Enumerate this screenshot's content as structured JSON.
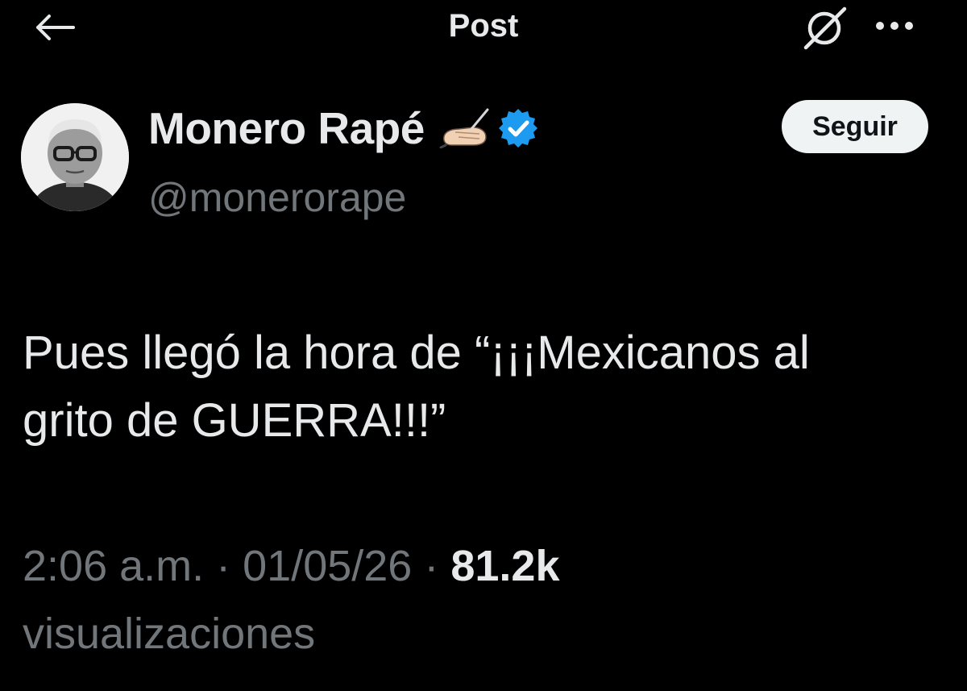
{
  "header": {
    "title": "Post",
    "back_icon": "arrow-left-icon",
    "grok_icon": "grok-icon",
    "more_icon": "more-horizontal-icon"
  },
  "author": {
    "display_name": "Monero Rapé",
    "emoji_icon": "writing-hand-emoji",
    "verified_icon": "verified-badge-icon",
    "handle": "@monerorape",
    "follow_label": "Seguir"
  },
  "tweet": {
    "text_line1": "Pues llegó la hora de “¡¡¡Mexicanos al",
    "text_line2": "grito de GUERRA!!!”",
    "time": "2:06 a.m.",
    "separator": "·",
    "date": "01/05/26",
    "views_count": "81.2k",
    "views_label": "visualizaciones"
  },
  "colors": {
    "background": "#000000",
    "text_primary": "#e7e9ea",
    "text_secondary": "#71767b",
    "verified_blue": "#1d9bf0",
    "follow_bg": "#eff3f4"
  }
}
